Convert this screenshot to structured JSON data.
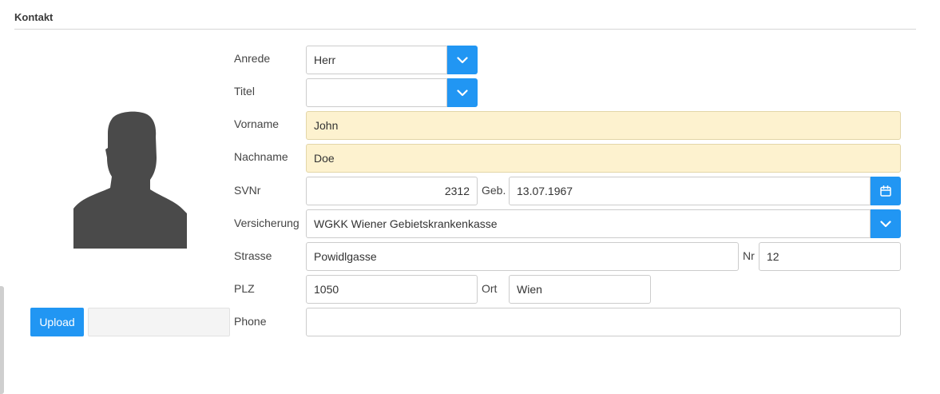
{
  "section": {
    "title": "Kontakt"
  },
  "photo": {
    "icon": "person-silhouette-icon",
    "upload_label": "Upload",
    "upload_value": ""
  },
  "form": {
    "anrede": {
      "label": "Anrede",
      "value": "Herr",
      "icon": "chevron-down-icon"
    },
    "titel": {
      "label": "Titel",
      "value": "",
      "icon": "chevron-down-icon"
    },
    "vorname": {
      "label": "Vorname",
      "value": "John"
    },
    "nachname": {
      "label": "Nachname",
      "value": "Doe"
    },
    "svnr": {
      "label": "SVNr",
      "value": "2312"
    },
    "geb": {
      "label": "Geb.",
      "value": "13.07.1967",
      "icon": "calendar-icon"
    },
    "versicherung": {
      "label": "Versicherung",
      "value": "WGKK Wiener Gebietskrankenkasse",
      "icon": "chevron-down-icon"
    },
    "strasse": {
      "label": "Strasse",
      "value": "Powidlgasse"
    },
    "nr": {
      "label": "Nr",
      "value": "12"
    },
    "plz": {
      "label": "PLZ",
      "value": "1050"
    },
    "ort": {
      "label": "Ort",
      "value": "Wien"
    },
    "phone": {
      "label": "Phone",
      "value": ""
    }
  },
  "colors": {
    "accent": "#2196f3",
    "required_bg": "#fdf2cf",
    "avatar": "#4a4a4a"
  }
}
